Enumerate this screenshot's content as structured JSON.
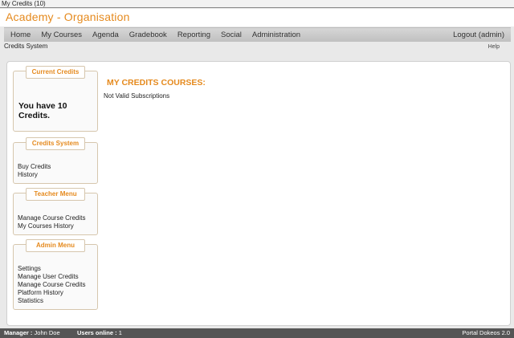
{
  "window": {
    "title": "My Credits (10)"
  },
  "header": {
    "brand": "Academy - Organisation"
  },
  "nav": {
    "items": [
      "Home",
      "My Courses",
      "Agenda",
      "Gradebook",
      "Reporting",
      "Social",
      "Administration"
    ],
    "logout": "Logout (admin)"
  },
  "breadcrumb": "Credits System",
  "help": "Help",
  "sidebar": {
    "current_credits": {
      "title": "Current Credits",
      "text": "You have 10 Credits."
    },
    "credits_system": {
      "title": "Credits System",
      "links": [
        "Buy Credits",
        "History"
      ]
    },
    "teacher_menu": {
      "title": "Teacher Menu",
      "links": [
        "Manage Course Credits",
        "My Courses History"
      ]
    },
    "admin_menu": {
      "title": "Admin Menu",
      "links": [
        "Settings",
        "Manage User Credits",
        "Manage Course Credits",
        "Platform History",
        "Statistics"
      ]
    }
  },
  "main": {
    "title": "MY CREDITS COURSES:",
    "message": "Not Valid Subscriptions"
  },
  "footer": {
    "manager_label": "Manager :",
    "manager_name": "John Doe",
    "online_label": "Users online :",
    "online_count": "1",
    "version": "Portal Dokeos 2.0"
  }
}
